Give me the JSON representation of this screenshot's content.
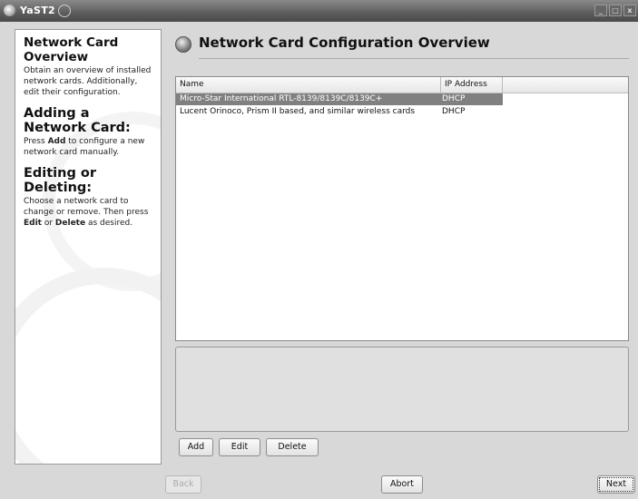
{
  "window": {
    "title": "YaST2",
    "controls": [
      "minimize",
      "maximize",
      "close"
    ]
  },
  "help": {
    "sections": [
      {
        "heading": "Network Card Overview",
        "text": "Obtain an overview of installed network cards. Additionally, edit their configuration."
      },
      {
        "heading": "Adding a Network Card:",
        "text_pre": "Press ",
        "bold1": "Add",
        "text_post": " to configure a new network card manually."
      },
      {
        "heading": "Editing or Deleting:",
        "text_pre": "Choose a network card to change or remove. Then press ",
        "bold1": "Edit",
        "mid": " or ",
        "bold2": "Delete",
        "text_post": " as desired."
      }
    ]
  },
  "main": {
    "title": "Network Card Configuration Overview",
    "table": {
      "columns": [
        "Name",
        "IP Address"
      ],
      "rows": [
        {
          "name": "Micro-Star International RTL-8139/8139C/8139C+",
          "ip": "DHCP",
          "selected": true
        },
        {
          "name": "Lucent Orinoco, Prism II based, and similar wireless cards",
          "ip": "DHCP",
          "selected": false
        }
      ]
    },
    "buttons": {
      "add": "Add",
      "edit": "Edit",
      "delete": "Delete"
    }
  },
  "footer": {
    "back": "Back",
    "abort": "Abort",
    "next": "Next"
  }
}
